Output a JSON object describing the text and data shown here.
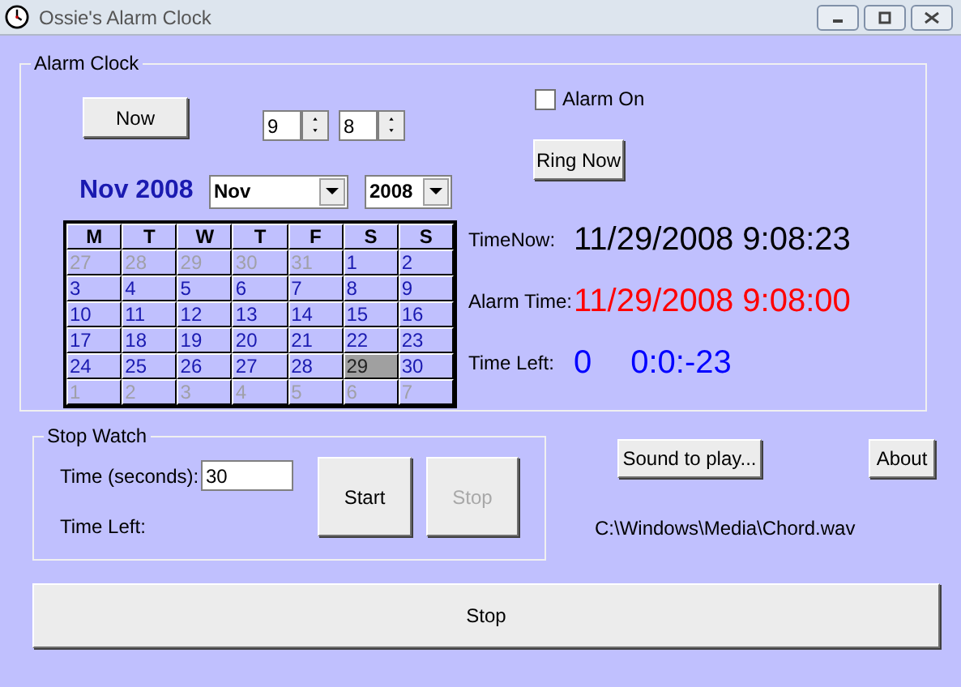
{
  "window": {
    "title": "Ossie's Alarm Clock"
  },
  "alarm_clock": {
    "title": "Alarm Clock",
    "now_button": "Now",
    "hour": "9",
    "minute": "8",
    "alarm_on": {
      "label": "Alarm On",
      "checked": false
    },
    "ring_now_button": "Ring Now",
    "month_heading": "Nov 2008",
    "month_select": "Nov",
    "year_select": "2008",
    "calendar": {
      "weekdays": [
        "M",
        "T",
        "W",
        "T",
        "F",
        "S",
        "S"
      ],
      "weeks": [
        [
          {
            "day": "27",
            "in_month": false,
            "selected": false
          },
          {
            "day": "28",
            "in_month": false,
            "selected": false
          },
          {
            "day": "29",
            "in_month": false,
            "selected": false
          },
          {
            "day": "30",
            "in_month": false,
            "selected": false
          },
          {
            "day": "31",
            "in_month": false,
            "selected": false
          },
          {
            "day": "1",
            "in_month": true,
            "selected": false
          },
          {
            "day": "2",
            "in_month": true,
            "selected": false
          }
        ],
        [
          {
            "day": "3",
            "in_month": true,
            "selected": false
          },
          {
            "day": "4",
            "in_month": true,
            "selected": false
          },
          {
            "day": "5",
            "in_month": true,
            "selected": false
          },
          {
            "day": "6",
            "in_month": true,
            "selected": false
          },
          {
            "day": "7",
            "in_month": true,
            "selected": false
          },
          {
            "day": "8",
            "in_month": true,
            "selected": false
          },
          {
            "day": "9",
            "in_month": true,
            "selected": false
          }
        ],
        [
          {
            "day": "10",
            "in_month": true,
            "selected": false
          },
          {
            "day": "11",
            "in_month": true,
            "selected": false
          },
          {
            "day": "12",
            "in_month": true,
            "selected": false
          },
          {
            "day": "13",
            "in_month": true,
            "selected": false
          },
          {
            "day": "14",
            "in_month": true,
            "selected": false
          },
          {
            "day": "15",
            "in_month": true,
            "selected": false
          },
          {
            "day": "16",
            "in_month": true,
            "selected": false
          }
        ],
        [
          {
            "day": "17",
            "in_month": true,
            "selected": false
          },
          {
            "day": "18",
            "in_month": true,
            "selected": false
          },
          {
            "day": "19",
            "in_month": true,
            "selected": false
          },
          {
            "day": "20",
            "in_month": true,
            "selected": false
          },
          {
            "day": "21",
            "in_month": true,
            "selected": false
          },
          {
            "day": "22",
            "in_month": true,
            "selected": false
          },
          {
            "day": "23",
            "in_month": true,
            "selected": false
          }
        ],
        [
          {
            "day": "24",
            "in_month": true,
            "selected": false
          },
          {
            "day": "25",
            "in_month": true,
            "selected": false
          },
          {
            "day": "26",
            "in_month": true,
            "selected": false
          },
          {
            "day": "27",
            "in_month": true,
            "selected": false
          },
          {
            "day": "28",
            "in_month": true,
            "selected": false
          },
          {
            "day": "29",
            "in_month": true,
            "selected": true
          },
          {
            "day": "30",
            "in_month": true,
            "selected": false
          }
        ],
        [
          {
            "day": "1",
            "in_month": false,
            "selected": false
          },
          {
            "day": "2",
            "in_month": false,
            "selected": false
          },
          {
            "day": "3",
            "in_month": false,
            "selected": false
          },
          {
            "day": "4",
            "in_month": false,
            "selected": false
          },
          {
            "day": "5",
            "in_month": false,
            "selected": false
          },
          {
            "day": "6",
            "in_month": false,
            "selected": false
          },
          {
            "day": "7",
            "in_month": false,
            "selected": false
          }
        ]
      ]
    },
    "time_now": {
      "label": "TimeNow:",
      "value": "11/29/2008 9:08:23"
    },
    "alarm_time": {
      "label": "Alarm Time:",
      "value": "11/29/2008 9:08:00"
    },
    "time_left": {
      "label": "Time Left:",
      "days": "0",
      "value": "0:0:-23"
    }
  },
  "stop_watch": {
    "title": "Stop Watch",
    "seconds_label": "Time (seconds):",
    "seconds_value": "30",
    "time_left_label": "Time Left:",
    "start_button": {
      "label": "Start",
      "disabled": false
    },
    "stop_button": {
      "label": "Stop",
      "disabled": true
    }
  },
  "sound_button": "Sound to play...",
  "about_button": "About",
  "sound_file": "C:\\Windows\\Media\\Chord.wav",
  "stop_button": "Stop"
}
